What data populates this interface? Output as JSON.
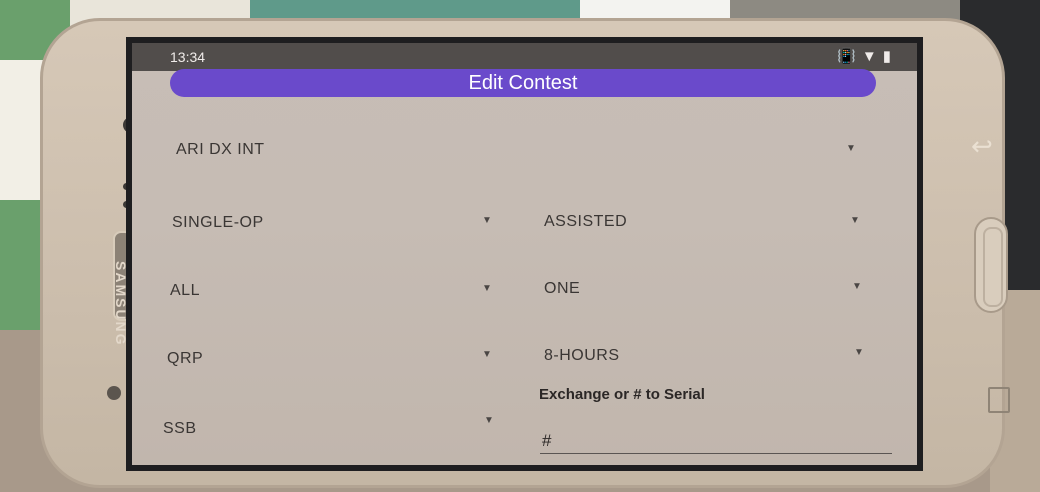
{
  "status_bar": {
    "time": "13:34",
    "icons": [
      "vibrate-icon",
      "wifi-icon",
      "battery-icon"
    ]
  },
  "app_bar": {
    "title": "Edit Contest"
  },
  "fields": {
    "contest": "ARI DX INT",
    "operator": "SINGLE-OP",
    "assisted": "ASSISTED",
    "band": "ALL",
    "transmitter": "ONE",
    "power": "QRP",
    "time": "8-HOURS",
    "mode": "SSB"
  },
  "exchange": {
    "label": "Exchange or # to Serial",
    "value": "#"
  },
  "phone": {
    "brand": "SAMSUNG"
  },
  "colors": {
    "accent": "#6a4acb",
    "status_bar": "#514d4b"
  }
}
